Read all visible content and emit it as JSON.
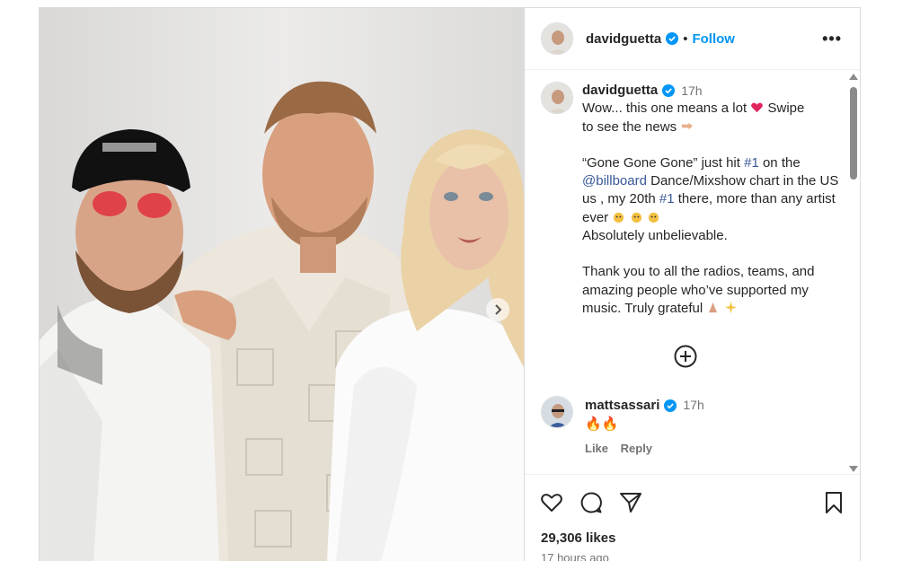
{
  "post": {
    "author": "davidguetta",
    "follow_label": "Follow",
    "separator": "•",
    "more_label": "•••"
  },
  "caption": {
    "username": "davidguetta",
    "time": "17h",
    "line1_text": "Wow... this one means a lot ",
    "line1_after": " Swipe",
    "line2_text": "to see the news ",
    "p2_a": "“Gone Gone Gone” just hit ",
    "p2_tag1": "#1",
    "p2_b": " on the ",
    "p2_mention": "@billboard",
    "p2_c": " Dance/Mixshow chart in the US us , my 20th ",
    "p2_tag2": "#1",
    "p2_d": " there, more than any artist ever ",
    "p2_e": "Absolutely unbelievable.",
    "p3": "Thank you to all the radios, teams, and amazing people who’ve supported my music. Truly grateful "
  },
  "comment": {
    "username": "mattsassari",
    "time": "17h",
    "text": "🔥🔥",
    "like_label": "Like",
    "reply_label": "Reply"
  },
  "stats": {
    "likes": "29,306 likes",
    "time_ago": "17 hours ago"
  },
  "icons": {
    "verified": "verified-badge-icon",
    "heart": "heart-icon",
    "comment": "comment-icon",
    "share": "share-icon",
    "save": "bookmark-icon",
    "add": "plus-circle-icon",
    "next": "chevron-right-icon"
  },
  "colors": {
    "link": "#0095f6",
    "verified": "#0095f6",
    "text": "#262626",
    "muted": "#737373"
  }
}
